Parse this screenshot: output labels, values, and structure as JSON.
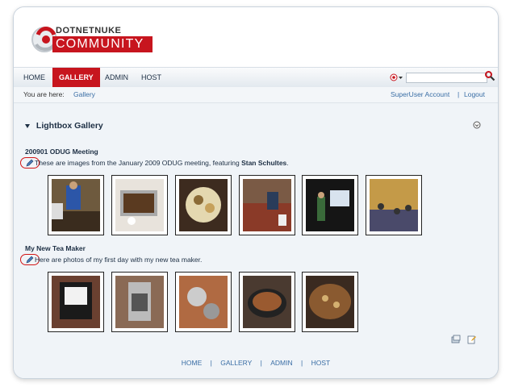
{
  "header": {
    "logo_top": "DOTNETNUKE",
    "logo_bottom": "COMMUNITY"
  },
  "nav": {
    "items": [
      "HOME",
      "GALLERY",
      "ADMIN",
      "HOST"
    ],
    "active": "GALLERY",
    "search_value": ""
  },
  "breadcrumb": {
    "label": "You are here:",
    "link": "Gallery"
  },
  "user": {
    "account": "SuperUser Account",
    "separator": "|",
    "logout": "Logout"
  },
  "module": {
    "title": "Lightbox Gallery"
  },
  "albums": [
    {
      "title": "200901 ODUG Meeting",
      "description_prefix": "These are images from the January 2009 ODUG meeting, featuring ",
      "description_bold": "Stan Schultes",
      "description_suffix": ".",
      "photo_count": 6
    },
    {
      "title": "My New Tea Maker",
      "description": "Here are photos of my first day with my new tea maker.",
      "photo_count": 5
    }
  ],
  "footer": {
    "links": [
      "HOME",
      "GALLERY",
      "ADMIN",
      "HOST"
    ],
    "separator": "|"
  },
  "colors": {
    "brand_red": "#c7151e",
    "link_blue": "#3a6ea5",
    "text_dark": "#1d2f44",
    "highlight_circle": "#d21414"
  },
  "icons": [
    "search-icon",
    "flag-icon",
    "collapse-arrow-icon",
    "settings-icon",
    "edit-pencil-icon",
    "photo-gallery-icon",
    "edit-module-icon"
  ]
}
